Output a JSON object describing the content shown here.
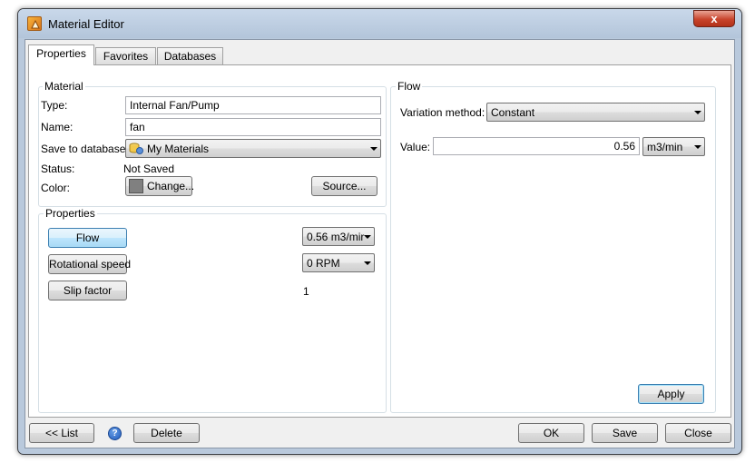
{
  "window": {
    "title": "Material Editor",
    "close_label": "x"
  },
  "tabs": [
    {
      "label": "Properties",
      "active": true
    },
    {
      "label": "Favorites",
      "active": false
    },
    {
      "label": "Databases",
      "active": false
    }
  ],
  "material": {
    "group_title": "Material",
    "type_label": "Type:",
    "type_value": "Internal Fan/Pump",
    "name_label": "Name:",
    "name_value": "fan",
    "save_label": "Save to database:",
    "save_value": "My Materials",
    "status_label": "Status:",
    "status_value": "Not Saved",
    "color_label": "Color:",
    "color_button": "Change...",
    "color_swatch": "#808080",
    "source_button": "Source..."
  },
  "properties": {
    "group_title": "Properties",
    "items": [
      {
        "label": "Flow",
        "value": "0.56 m3/mir",
        "selected": true
      },
      {
        "label": "Rotational speed",
        "value": "0 RPM"
      },
      {
        "label": "Slip factor",
        "value": "1"
      }
    ]
  },
  "flow": {
    "group_title": "Flow",
    "variation_label": "Variation method:",
    "variation_value": "Constant",
    "value_label": "Value:",
    "value": "0.56",
    "unit": "m3/min",
    "apply_button": "Apply"
  },
  "footer": {
    "list_button": "<< List",
    "help_icon": "?",
    "delete_button": "Delete",
    "ok_button": "OK",
    "save_button": "Save",
    "close_button": "Close"
  },
  "colors": {
    "accent": "#3c7fb1",
    "title_bar": "#b9c9dc",
    "close_red": "#c8442c"
  }
}
